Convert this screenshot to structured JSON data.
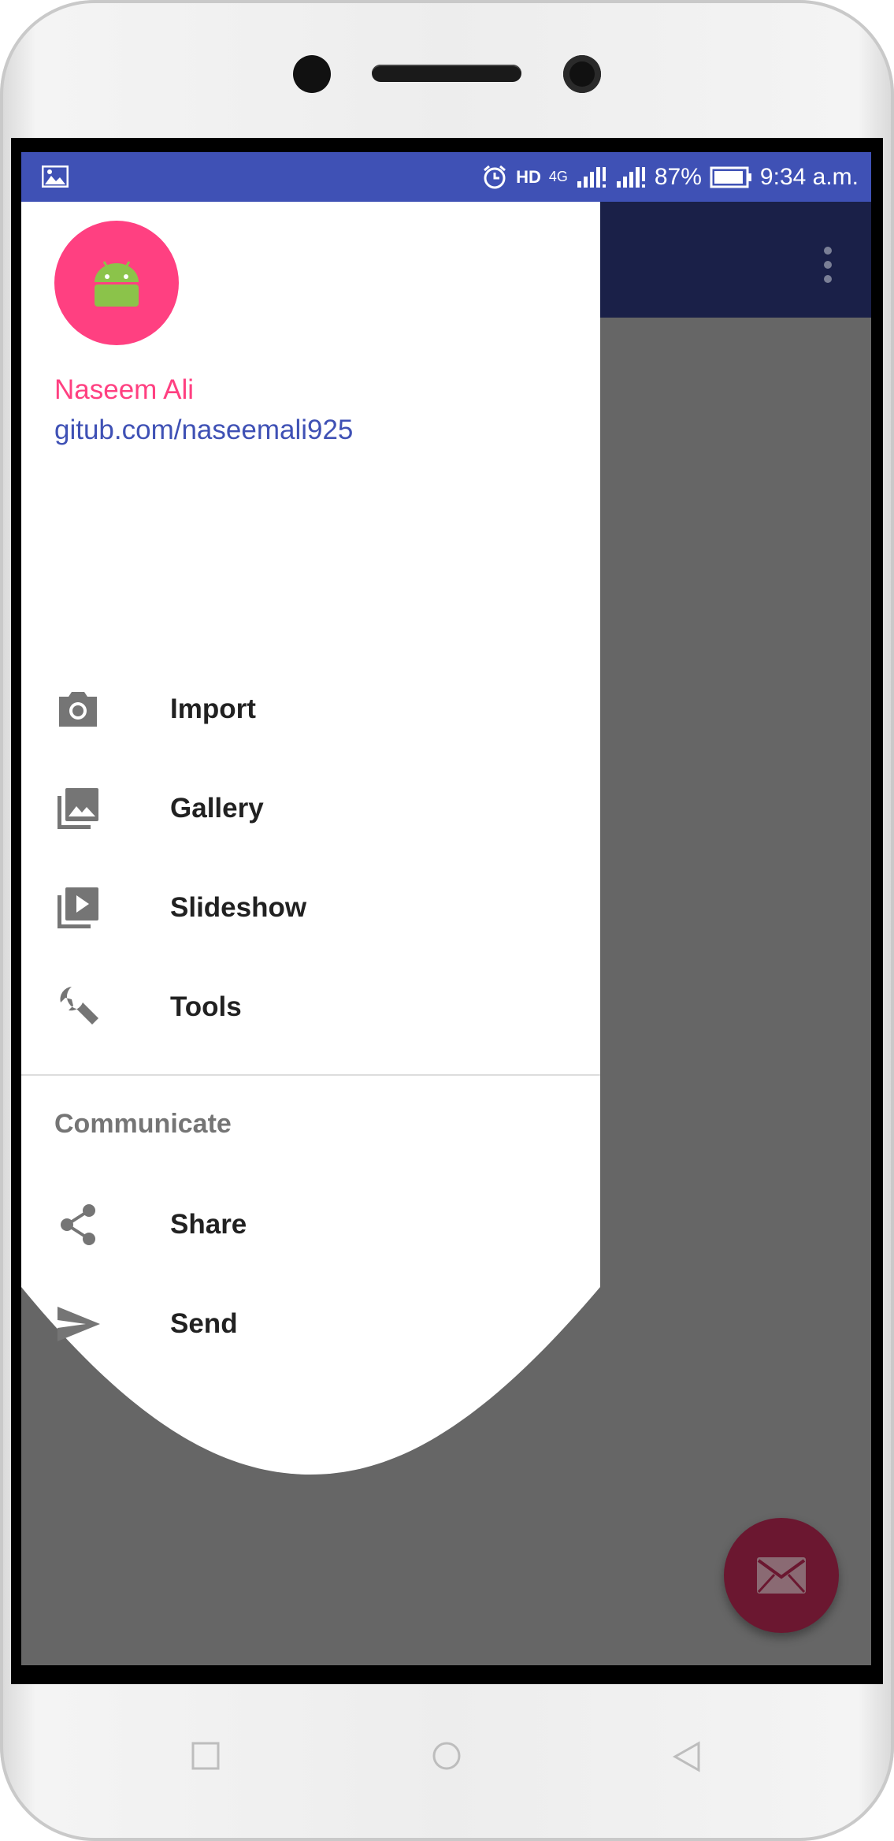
{
  "status_bar": {
    "battery": "87%",
    "time": "9:34 a.m.",
    "network": "4G",
    "hd_label": "HD",
    "icons": [
      "image-icon",
      "alarm-icon",
      "signal-icon",
      "battery-icon"
    ]
  },
  "colors": {
    "primary": "#3f51b5",
    "accent": "#ff4081",
    "toolbar_dimmed": "#1a2048",
    "scrim": "#666666",
    "fab_dimmed": "#6b1730"
  },
  "header": {
    "name": "Naseem Ali",
    "link": "gitub.com/naseemali925",
    "avatar_icon": "android-icon"
  },
  "menu": {
    "items": [
      {
        "label": "Import",
        "icon": "camera-icon"
      },
      {
        "label": "Gallery",
        "icon": "gallery-icon"
      },
      {
        "label": "Slideshow",
        "icon": "slideshow-icon"
      },
      {
        "label": "Tools",
        "icon": "wrench-icon"
      }
    ],
    "section": {
      "title": "Communicate",
      "items": [
        {
          "label": "Share",
          "icon": "share-icon"
        },
        {
          "label": "Send",
          "icon": "send-icon"
        }
      ]
    }
  },
  "fab": {
    "icon": "mail-icon"
  },
  "nav_buttons": [
    "recents-icon",
    "home-icon",
    "back-icon"
  ]
}
